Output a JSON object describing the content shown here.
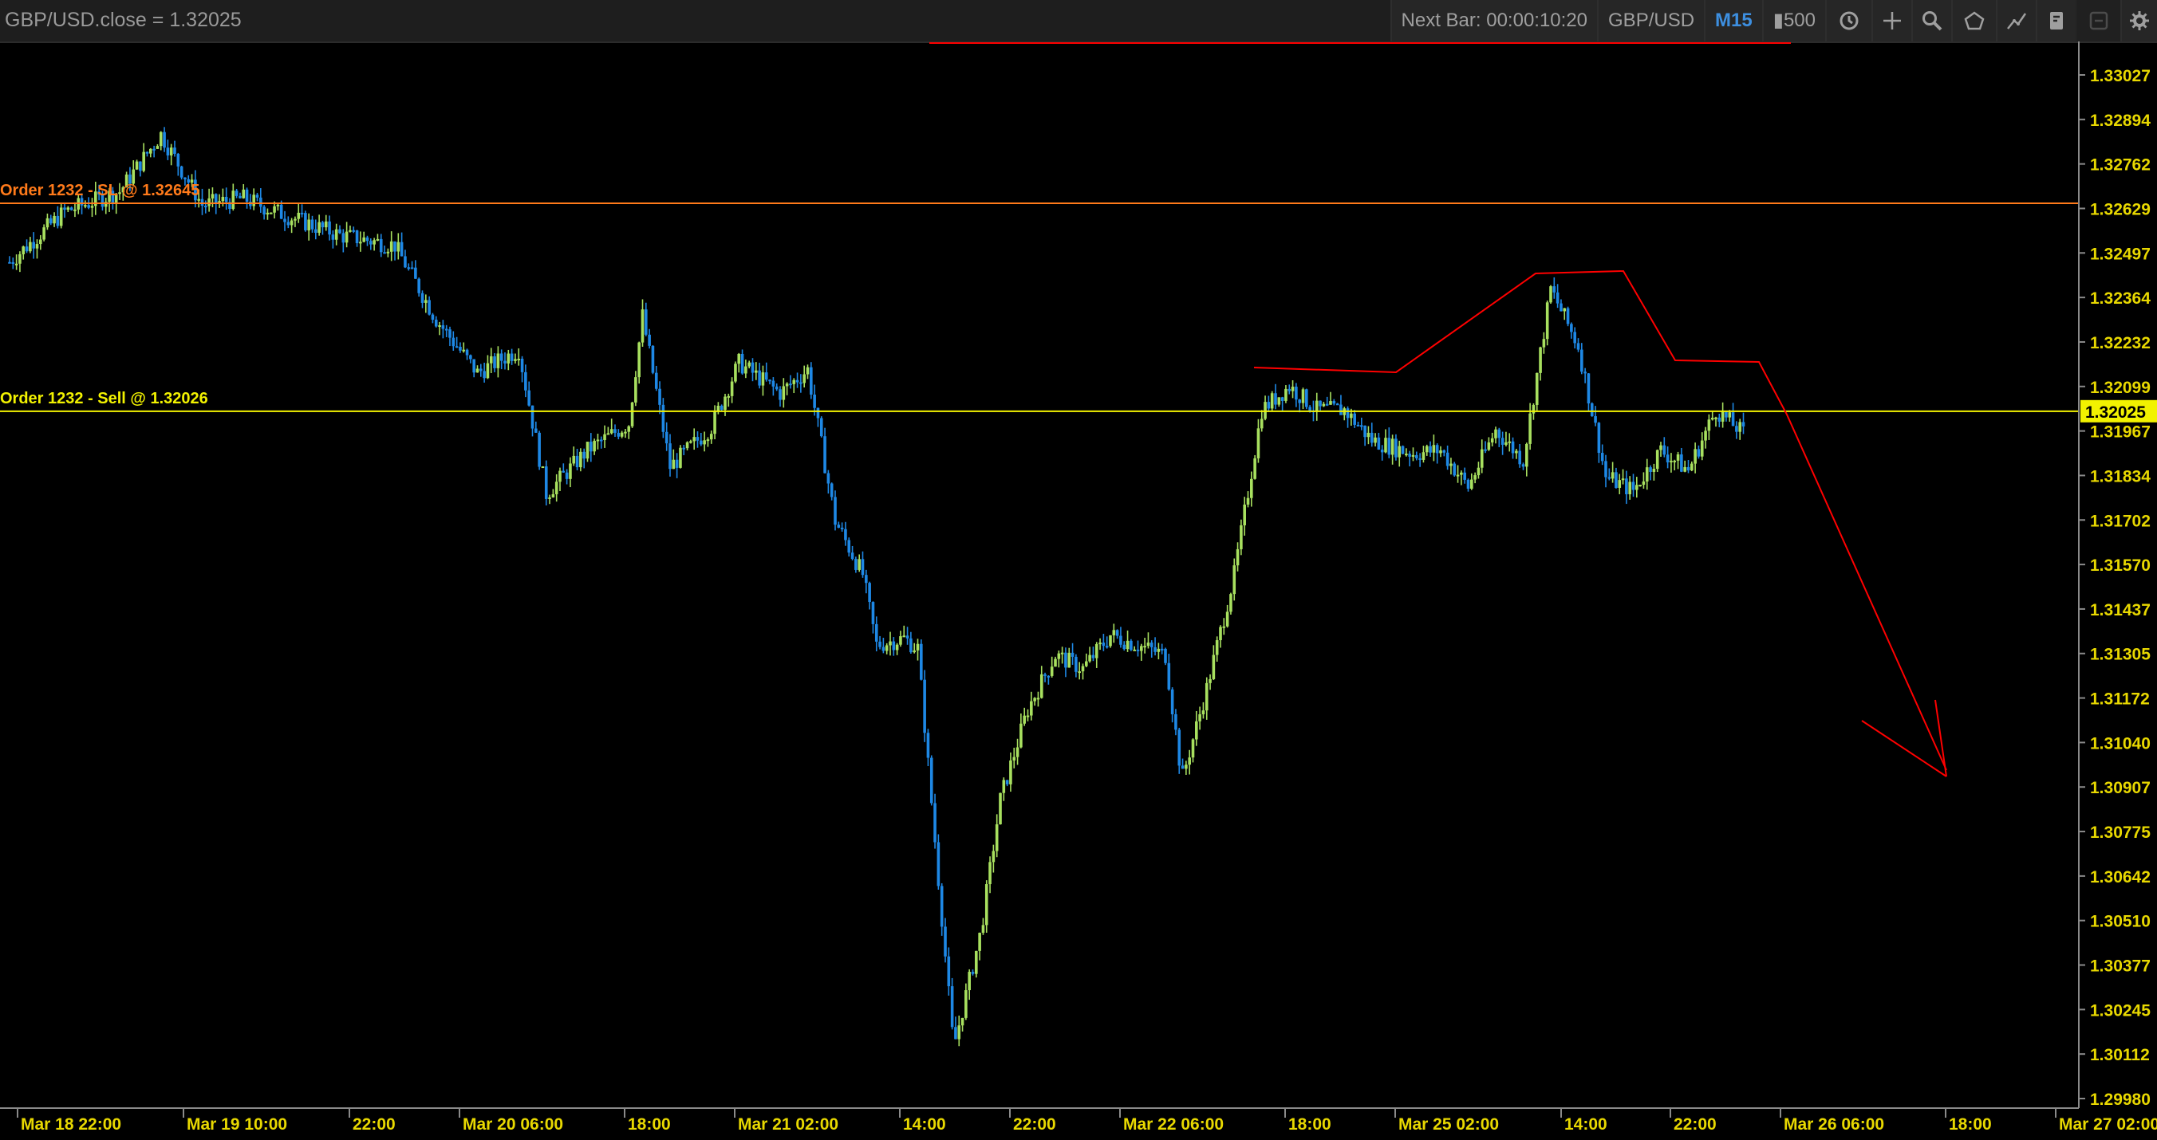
{
  "title": "GBP/USD.close = 1.32025",
  "toolbar": {
    "next_bar": "Next Bar: 00:00:10:20",
    "symbol": "GBP/USD",
    "timeframe": "M15",
    "bar_count": "500",
    "icons": [
      "refresh-icon",
      "crosshair-icon",
      "zoom-icon",
      "shape-icon",
      "line-tool-icon",
      "template-icon",
      "disabled-tool-icon",
      "settings-icon"
    ]
  },
  "orders": [
    {
      "label": "Order 1232 - SL @ 1.32645",
      "price": 1.32645,
      "color": "#ff7a1a"
    },
    {
      "label": "Order 1232 - Sell @ 1.32026",
      "price": 1.32026,
      "color": "#f2f200"
    }
  ],
  "current_price_tag": "1.32025",
  "colors": {
    "up_bar": "#a8e05f",
    "down_bar": "#1e88e5",
    "drawing": "#ff0000",
    "axis_text": "#e8d800"
  },
  "chart_data": {
    "type": "candlestick",
    "symbol": "GBP/USD",
    "timeframe": "M15",
    "y_ticks": [
      "1.33027",
      "1.32894",
      "1.32762",
      "1.32629",
      "1.32497",
      "1.32364",
      "1.32232",
      "1.32099",
      "1.31967",
      "1.31834",
      "1.31702",
      "1.31570",
      "1.31437",
      "1.31305",
      "1.31172",
      "1.31040",
      "1.30907",
      "1.30775",
      "1.30642",
      "1.30510",
      "1.30377",
      "1.30245",
      "1.30112",
      "1.29980"
    ],
    "x_ticks": [
      "Mar 18 22:00",
      "Mar 19 10:00",
      "22:00",
      "Mar 20 06:00",
      "18:00",
      "Mar 21 02:00",
      "14:00",
      "22:00",
      "Mar 22 06:00",
      "18:00",
      "Mar 25 02:00",
      "14:00",
      "22:00",
      "Mar 26 06:00",
      "18:00",
      "Mar 27 02:00"
    ],
    "ylim": [
      1.2998,
      1.3309
    ],
    "price_path": [
      [
        0,
        1.3247
      ],
      [
        2,
        1.3262
      ],
      [
        4,
        1.3268
      ],
      [
        5.5,
        1.3285
      ],
      [
        7,
        1.3264
      ],
      [
        8.5,
        1.3266
      ],
      [
        10,
        1.3261
      ],
      [
        12,
        1.3255
      ],
      [
        14,
        1.3252
      ],
      [
        15.5,
        1.323
      ],
      [
        17,
        1.3214
      ],
      [
        18.5,
        1.3221
      ],
      [
        19.5,
        1.3178
      ],
      [
        21,
        1.3191
      ],
      [
        22.5,
        1.3199
      ],
      [
        23,
        1.3231
      ],
      [
        24,
        1.3186
      ],
      [
        25.5,
        1.3198
      ],
      [
        26.5,
        1.3217
      ],
      [
        28,
        1.3208
      ],
      [
        29,
        1.3215
      ],
      [
        30,
        1.317
      ],
      [
        31,
        1.3154
      ],
      [
        31.5,
        1.3133
      ],
      [
        32.5,
        1.3135
      ],
      [
        33,
        1.3132
      ],
      [
        33.6,
        1.3077
      ],
      [
        34.3,
        1.3013
      ],
      [
        35.3,
        1.3048
      ],
      [
        36,
        1.3087
      ],
      [
        37,
        1.3114
      ],
      [
        38,
        1.313
      ],
      [
        39,
        1.3126
      ],
      [
        40,
        1.3136
      ],
      [
        41,
        1.3133
      ],
      [
        42,
        1.313
      ],
      [
        42.6,
        1.3093
      ],
      [
        43.5,
        1.312
      ],
      [
        44.5,
        1.3154
      ],
      [
        45.5,
        1.3203
      ],
      [
        46.5,
        1.321
      ],
      [
        47.5,
        1.3203
      ],
      [
        48.5,
        1.3203
      ],
      [
        49.5,
        1.3194
      ],
      [
        51,
        1.319
      ],
      [
        52,
        1.3191
      ],
      [
        53,
        1.318
      ],
      [
        54,
        1.3197
      ],
      [
        55,
        1.3188
      ],
      [
        56,
        1.3239
      ],
      [
        57,
        1.3222
      ],
      [
        58,
        1.3183
      ],
      [
        59,
        1.3179
      ],
      [
        60,
        1.3191
      ],
      [
        61,
        1.3185
      ],
      [
        62,
        1.3203
      ],
      [
        63,
        1.3196
      ]
    ]
  }
}
